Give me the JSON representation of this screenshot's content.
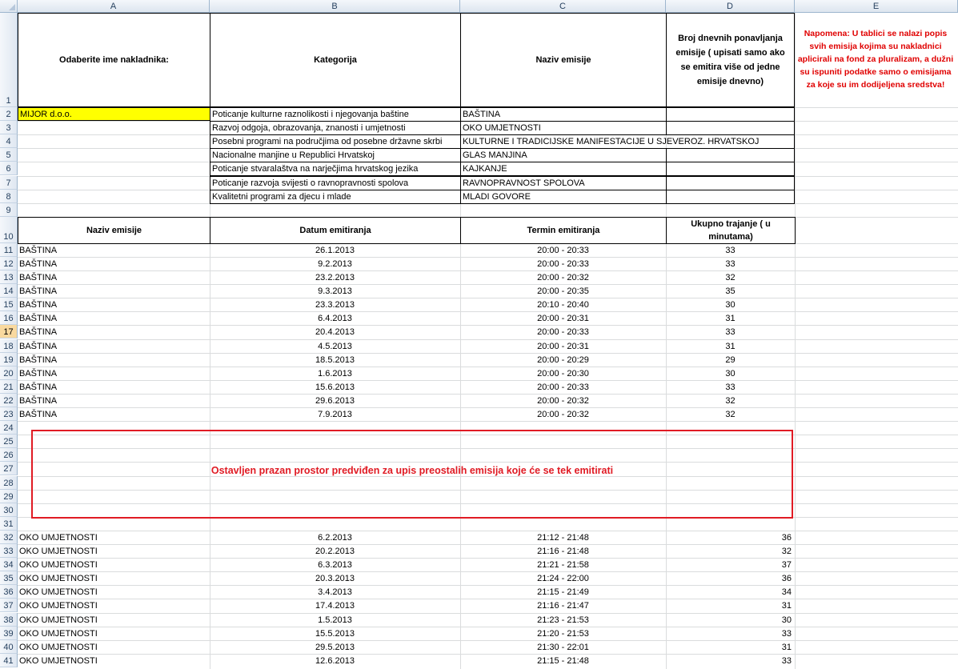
{
  "columns": [
    "A",
    "B",
    "C",
    "D",
    "E"
  ],
  "row_numbers": [
    "1",
    "2",
    "3",
    "4",
    "5",
    "6",
    "7",
    "8",
    "9",
    "10",
    "11",
    "12",
    "13",
    "14",
    "15",
    "16",
    "17",
    "18",
    "19",
    "20",
    "21",
    "22",
    "23",
    "24",
    "25",
    "26",
    "27",
    "28",
    "29",
    "30",
    "31",
    "32",
    "33",
    "34",
    "35",
    "36",
    "37",
    "38",
    "39",
    "40",
    "41"
  ],
  "selected_row": "17",
  "header": {
    "a": "Odaberite ime nakladnika:",
    "b": "Kategorija",
    "c": "Naziv emisije",
    "d": "Broj dnevnih ponavljanja emisije ( upisati samo ako se emitira više od jedne emisije dnevno)"
  },
  "note": "Napomena: U tablici se nalazi popis svih emisija kojima su nakladnici aplicirali na fond za pluralizam, a dužni su ispuniti podatke samo o emisijama za koje su im dodijeljena sredstva!",
  "publisher": "MIJOR d.o.o.",
  "categories": [
    {
      "category": "Poticanje kulturne raznolikosti i njegovanja baštine",
      "show": "BAŠTINA"
    },
    {
      "category": "Razvoj odgoja, obrazovanja, znanosti i umjetnosti",
      "show": "OKO UMJETNOSTI"
    },
    {
      "category": "Posebni programi na područjima od posebne državne skrbi",
      "show": "KULTURNE I TRADICIJSKE MANIFESTACIJE U SJEVEROZ. HRVATSKOJ"
    },
    {
      "category": "Nacionalne manjine u Republici Hrvatskoj",
      "show": "GLAS MANJINA"
    },
    {
      "category": "Poticanje stvaralaštva na narječjima hrvatskog jezika",
      "show": "KAJKANJE"
    },
    {
      "category": "Poticanje razvoja svijesti o ravnopravnosti spolova",
      "show": "RAVNOPRAVNOST SPOLOVA"
    },
    {
      "category": "Kvalitetni programi za djecu i mlade",
      "show": "MLADI GOVORE"
    }
  ],
  "table_header": {
    "name": "Naziv emisije",
    "date": "Datum emitiranja",
    "slot": "Termin emitiranja",
    "duration": "Ukupno trajanje ( u minutama)"
  },
  "rows_bastina": [
    [
      "BAŠTINA",
      "26.1.2013",
      "20:00 - 20:33",
      "33"
    ],
    [
      "BAŠTINA",
      "9.2.2013",
      "20:00 - 20:33",
      "33"
    ],
    [
      "BAŠTINA",
      "23.2.2013",
      "20:00 - 20:32",
      "32"
    ],
    [
      "BAŠTINA",
      "9.3.2013",
      "20:00 - 20:35",
      "35"
    ],
    [
      "BAŠTINA",
      "23.3.2013",
      "20:10 - 20:40",
      "30"
    ],
    [
      "BAŠTINA",
      "6.4.2013",
      "20:00 - 20:31",
      "31"
    ],
    [
      "BAŠTINA",
      "20.4.2013",
      "20:00 - 20:33",
      "33"
    ],
    [
      "BAŠTINA",
      "4.5.2013",
      "20:00 - 20:31",
      "31"
    ],
    [
      "BAŠTINA",
      "18.5.2013",
      "20:00 - 20:29",
      "29"
    ],
    [
      "BAŠTINA",
      "1.6.2013",
      "20:00 - 20:30",
      "30"
    ],
    [
      "BAŠTINA",
      "15.6.2013",
      "20:00 - 20:33",
      "33"
    ],
    [
      "BAŠTINA",
      "29.6.2013",
      "20:00 - 20:32",
      "32"
    ],
    [
      "BAŠTINA",
      "7.9.2013",
      "20:00 - 20:32",
      "32"
    ]
  ],
  "placeholder_text": "Ostavljen prazan prostor predviđen za upis preostalih emisija koje će se tek emitirati",
  "rows_oko": [
    [
      "OKO UMJETNOSTI",
      "6.2.2013",
      "21:12 - 21:48",
      "36"
    ],
    [
      "OKO UMJETNOSTI",
      "20.2.2013",
      "21:16 - 21:48",
      "32"
    ],
    [
      "OKO UMJETNOSTI",
      "6.3.2013",
      "21:21 - 21:58",
      "37"
    ],
    [
      "OKO UMJETNOSTI",
      "20.3.2013",
      "21:24 - 22:00",
      "36"
    ],
    [
      "OKO UMJETNOSTI",
      "3.4.2013",
      "21:15 - 21:49",
      "34"
    ],
    [
      "OKO UMJETNOSTI",
      "17.4.2013",
      "21:16 - 21:47",
      "31"
    ],
    [
      "OKO UMJETNOSTI",
      "1.5.2013",
      "21:23 - 21:53",
      "30"
    ],
    [
      "OKO UMJETNOSTI",
      "15.5.2013",
      "21:20 - 21:53",
      "33"
    ],
    [
      "OKO UMJETNOSTI",
      "29.5.2013",
      "21:30 - 22:01",
      "31"
    ],
    [
      "OKO UMJETNOSTI",
      "12.6.2013",
      "21:15 - 21:48",
      "33"
    ]
  ]
}
